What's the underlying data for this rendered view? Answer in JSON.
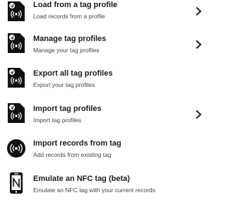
{
  "menu": {
    "items": [
      {
        "title": "Load from a tag profile",
        "subtitle": "Load records from a profile",
        "icon": "tag-profile-icon",
        "has_submenu": true
      },
      {
        "title": "Manage tag profiles",
        "subtitle": "Manage your tag profiles",
        "icon": "tag-profile-icon",
        "has_submenu": true
      },
      {
        "title": "Export all tag profiles",
        "subtitle": "Export your tag profiles",
        "icon": "tag-profile-icon",
        "has_submenu": false
      },
      {
        "title": "Import tag profiles",
        "subtitle": "Import tag profiles",
        "icon": "tag-profile-icon",
        "has_submenu": true
      },
      {
        "title": "Import records from tag",
        "subtitle": "Add records from existing tag",
        "icon": "nfc-read-icon",
        "has_submenu": false
      },
      {
        "title": "Emulate an NFC tag (beta)",
        "subtitle": "Emulate an NFC tag with your current records",
        "icon": "phone-nfc-icon",
        "has_submenu": false
      }
    ]
  }
}
